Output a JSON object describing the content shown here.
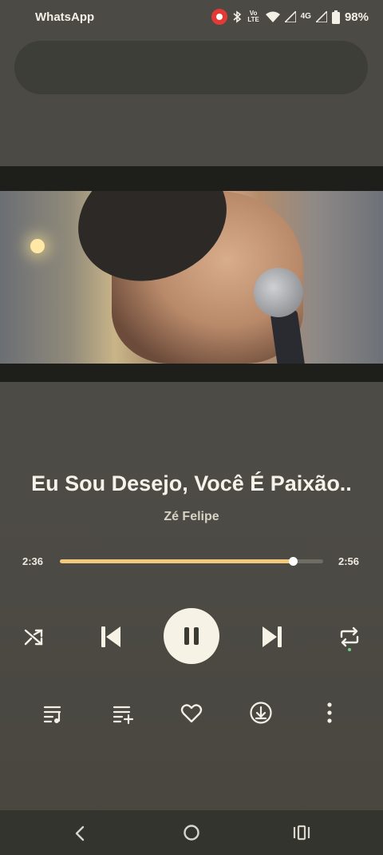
{
  "status_bar": {
    "app_name": "WhatsApp",
    "volte": "Vo LTE",
    "network": "4G",
    "battery": "98%"
  },
  "player": {
    "title": "Eu Sou Desejo, Você É Paixão..",
    "artist": "Zé Felipe",
    "current_time": "2:36",
    "total_time": "2:56",
    "progress": 0.886
  },
  "colors": {
    "accent": "#f2c97b",
    "background": "#4c4a44",
    "repeat_indicator": "#6fd08a"
  },
  "icons": {
    "shuffle": "shuffle-icon",
    "previous": "skip-previous-icon",
    "pause": "pause-icon",
    "next": "skip-next-icon",
    "repeat": "repeat-icon",
    "queue": "queue-music-icon",
    "add_to_playlist": "playlist-add-icon",
    "like": "heart-icon",
    "download": "download-icon",
    "more": "more-vert-icon"
  }
}
